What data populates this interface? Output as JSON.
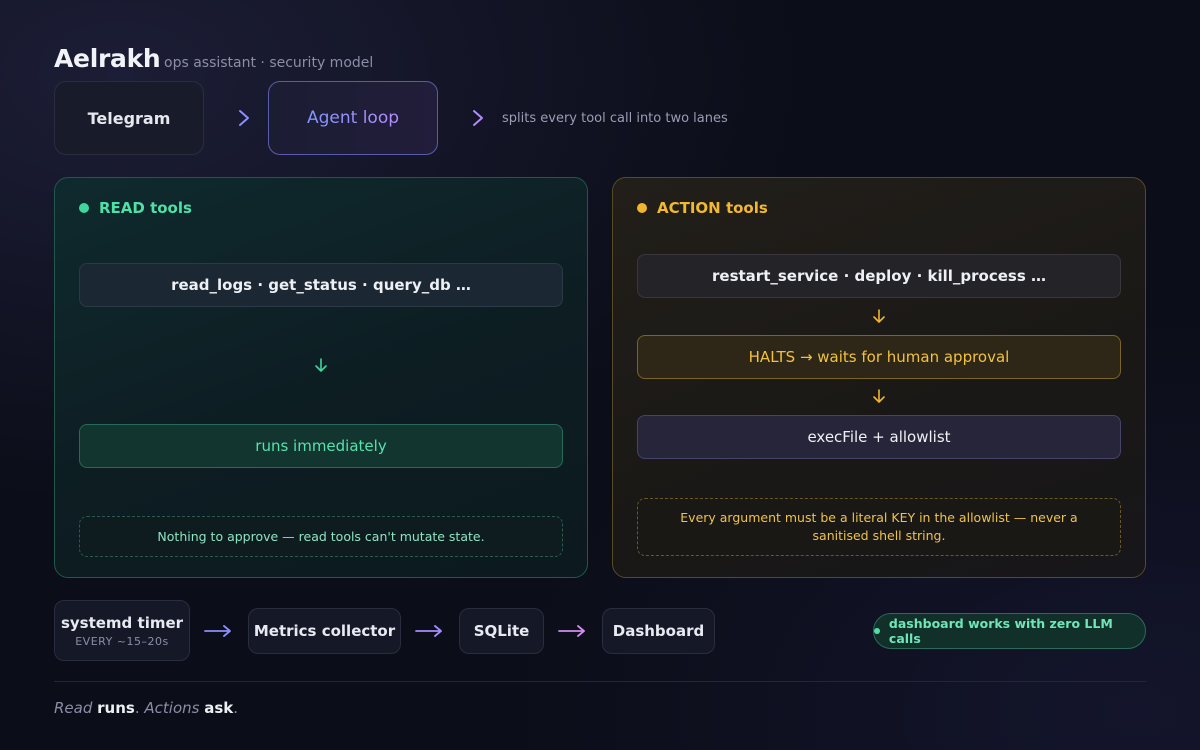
{
  "header": {
    "title": "Aelrakh",
    "subtitle": "ops assistant · security model"
  },
  "flow": {
    "source": "Telegram",
    "agent": "Agent loop",
    "note": "splits every tool call into two lanes"
  },
  "read_lane": {
    "title": "READ tools",
    "tools": "read_logs · get_status · query_db …",
    "result": "runs immediately",
    "note": "Nothing to approve — read tools can't mutate state."
  },
  "action_lane": {
    "title": "ACTION tools",
    "tools": "restart_service · deploy · kill_process …",
    "halt": "HALTS → waits for human approval",
    "exec": "execFile + allowlist",
    "note": "Every argument must be a literal KEY in the allowlist — never a sanitised shell string."
  },
  "pipeline": {
    "timer": "systemd timer",
    "timer_sub": "EVERY ~15–20s",
    "collector": "Metrics collector",
    "store": "SQLite",
    "dashboard": "Dashboard",
    "badge": "dashboard works with zero LLM calls"
  },
  "footer": {
    "read_word": "Read",
    "read_verb": "runs",
    "sep": ".",
    "action_word": "Actions",
    "action_verb": "ask",
    "end": "."
  },
  "colors": {
    "read_accent": "#3fd69c",
    "action_accent": "#f0b52b",
    "agent_accent": "#8f92ff",
    "background": "#0b0d18"
  },
  "icons": {
    "flow_arrow": "chevron-right-icon",
    "step_arrow": "arrow-down-icon",
    "pipeline_arrow": "arrow-right-icon"
  }
}
